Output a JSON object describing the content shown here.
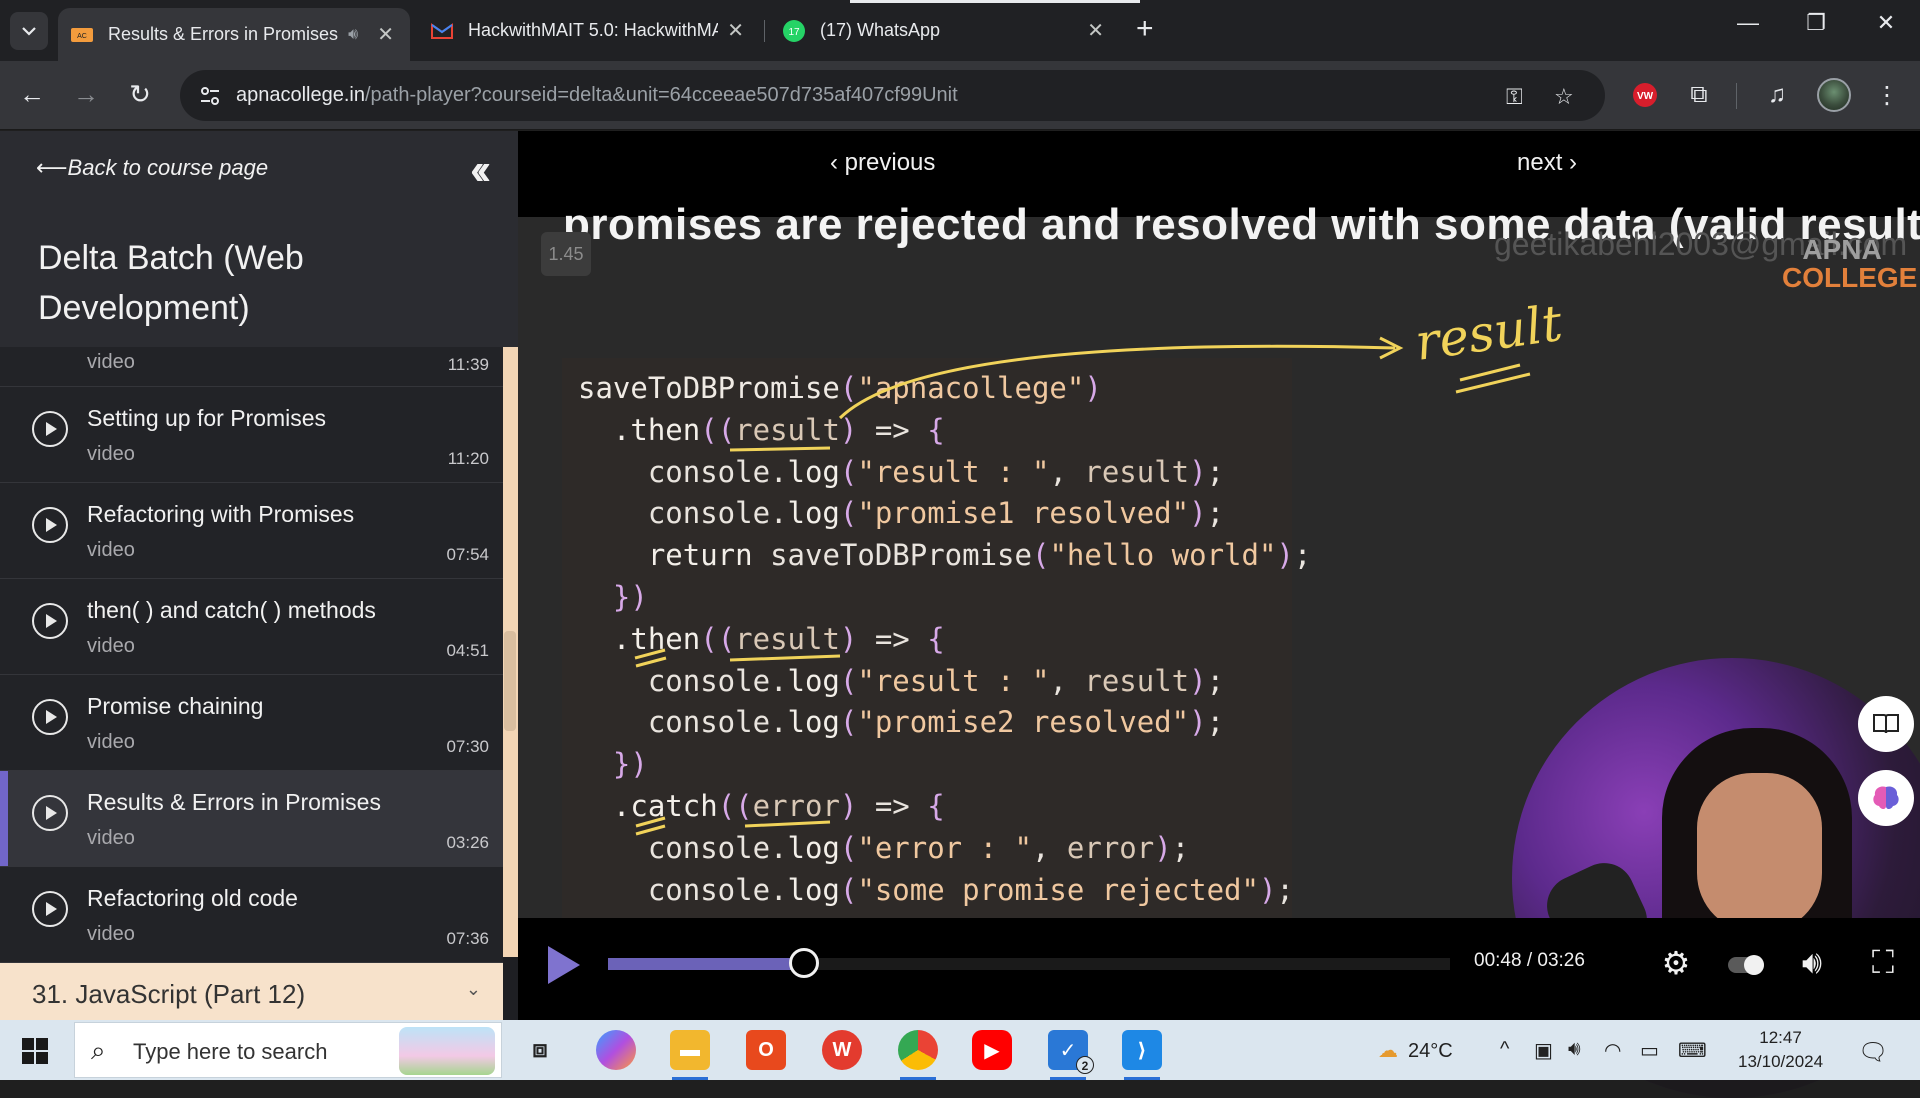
{
  "browser": {
    "tabs": [
      {
        "title": "Results & Errors in Promises",
        "favicon": "apna-college-icon",
        "active": true
      },
      {
        "title": "HackwithMAIT 5.0: HackwithMA",
        "favicon": "gmail-icon",
        "active": false
      },
      {
        "title": "(17) WhatsApp",
        "favicon": "whatsapp-icon",
        "badge": "17",
        "active": false
      }
    ],
    "url_host": "apnacollege.in",
    "url_path": "/path-player?courseid=delta&unit=64cceeae507d735af407cf99Unit"
  },
  "sidebar": {
    "back_label": "Back to course page",
    "course_title": "Delta Batch (Web Development)",
    "partial_item": {
      "type": "video",
      "duration": "11:39"
    },
    "lessons": [
      {
        "title": "Setting up for Promises",
        "type": "video",
        "duration": "11:20"
      },
      {
        "title": "Refactoring with Promises",
        "type": "video",
        "duration": "07:54"
      },
      {
        "title": "then( ) and catch( ) methods",
        "type": "video",
        "duration": "04:51"
      },
      {
        "title": "Promise chaining",
        "type": "video",
        "duration": "07:30"
      },
      {
        "title": "Results & Errors in Promises",
        "type": "video",
        "duration": "03:26",
        "active": true
      },
      {
        "title": "Refactoring old code",
        "type": "video",
        "duration": "07:36"
      }
    ],
    "next_section": "31. JavaScript (Part 12)"
  },
  "player": {
    "prev_label": "previous",
    "next_label": "next",
    "slide_heading": "promises are rejected and resolved with some data (valid results or",
    "speed": "1.45",
    "watermark": "geetikabehl2003@gmail.com",
    "brand_line1": "APNA",
    "brand_line2": "COLLEGE",
    "annotation": "result",
    "time": "00:48 / 03:26",
    "progress": 0.233
  },
  "taskbar": {
    "search_placeholder": "Type here to search",
    "temperature": "24°C",
    "time": "12:47",
    "date": "13/10/2024",
    "todo_badge": "2"
  }
}
